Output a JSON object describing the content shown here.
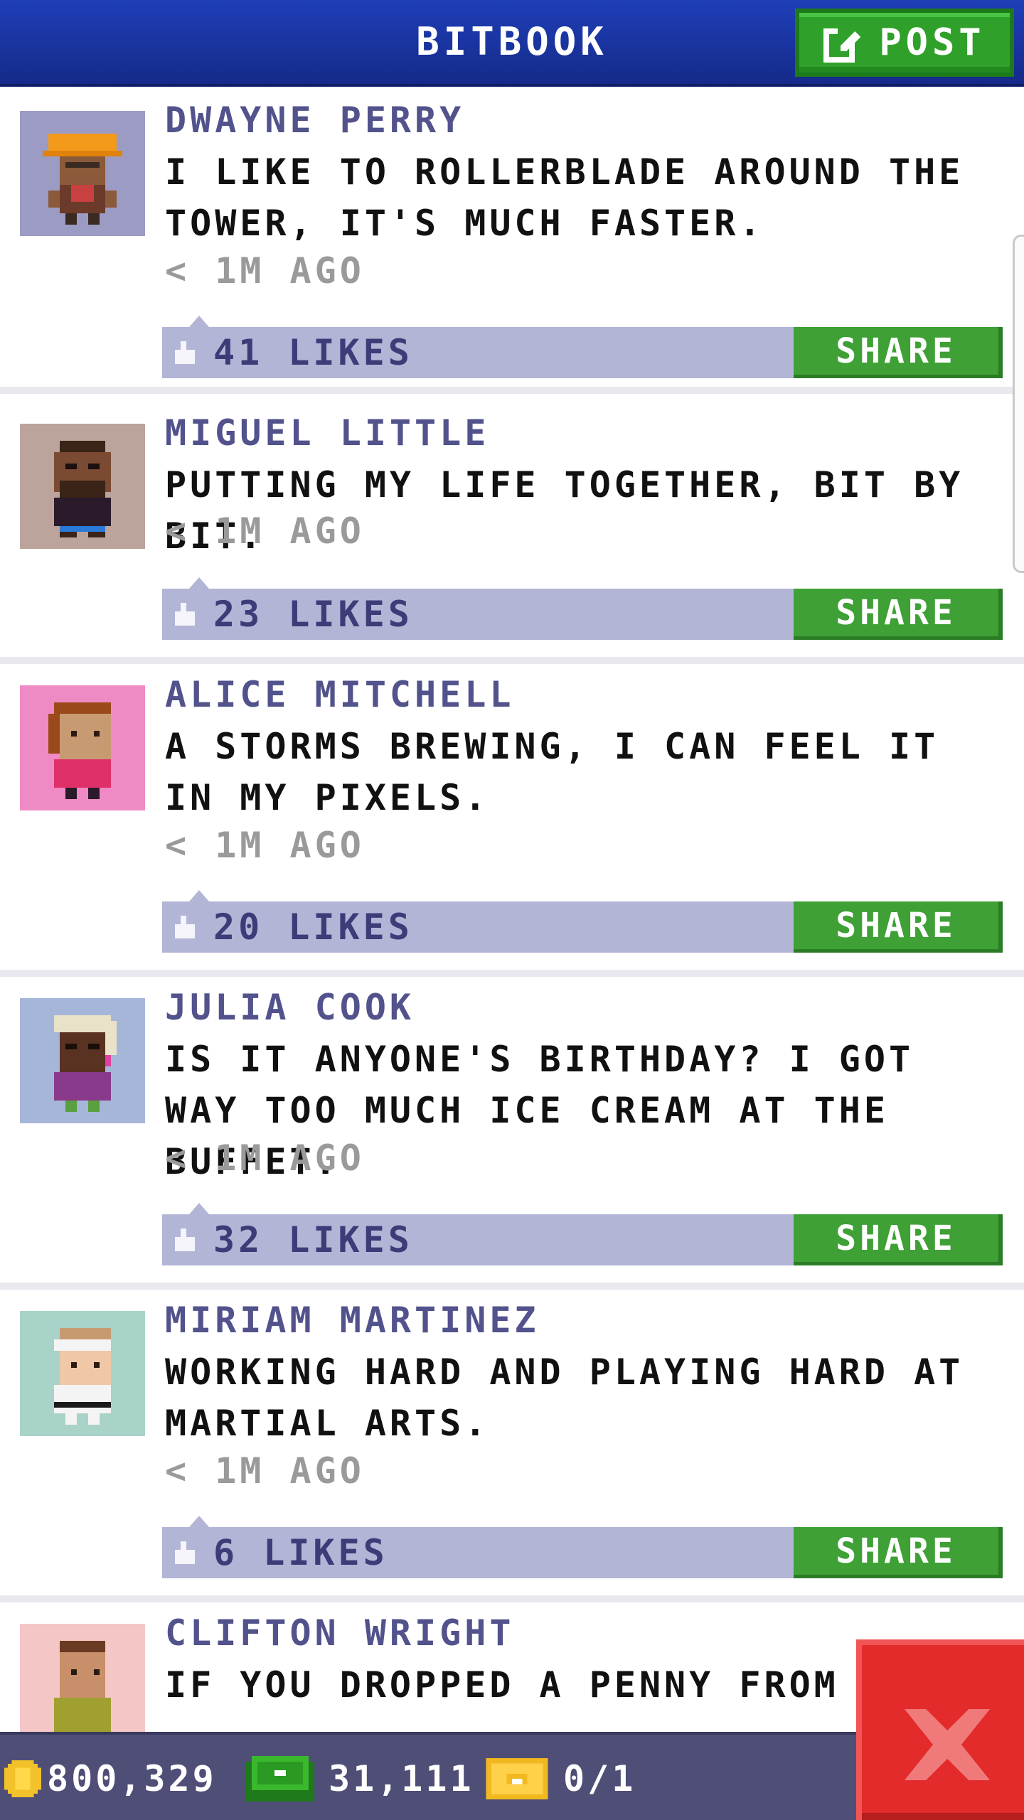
{
  "header": {
    "title": "BITBOOK",
    "post_label": "POST"
  },
  "posts": [
    {
      "name": "DWAYNE PERRY",
      "text": "I LIKE TO ROLLERBLADE AROUND THE TOWER, IT'S MUCH FASTER.",
      "time": "< 1M AGO",
      "likes": "41 LIKES",
      "share_label": "SHARE",
      "avatar_bg": "#9b9bc4"
    },
    {
      "name": "MIGUEL LITTLE",
      "text": "PUTTING MY LIFE TOGETHER, BIT BY BIT.",
      "time": "< 1M AGO",
      "likes": "23 LIKES",
      "share_label": "SHARE",
      "avatar_bg": "#bca49c"
    },
    {
      "name": "ALICE MITCHELL",
      "text": "A STORMS BREWING, I CAN FEEL IT IN MY PIXELS.",
      "time": "< 1M AGO",
      "likes": "20 LIKES",
      "share_label": "SHARE",
      "avatar_bg": "#f08ac4"
    },
    {
      "name": "JULIA COOK",
      "text": "IS IT ANYONE'S BIRTHDAY? I GOT WAY TOO MUCH ICE CREAM AT THE BUFFET.",
      "time": "< 1M AGO",
      "likes": "32 LIKES",
      "share_label": "SHARE",
      "avatar_bg": "#a6b6d8"
    },
    {
      "name": "MIRIAM MARTINEZ",
      "text": "WORKING HARD AND PLAYING HARD AT MARTIAL ARTS.",
      "time": "< 1M AGO",
      "likes": "6 LIKES",
      "share_label": "SHARE",
      "avatar_bg": "#a9d2c8"
    },
    {
      "name": "CLIFTON WRIGHT",
      "text": "IF YOU DROPPED A PENNY FROM",
      "avatar_bg": "#f4c6c6"
    }
  ],
  "status_bar": {
    "coins": "800,329",
    "bux": "31,111",
    "tickets": "0/1"
  },
  "colors": {
    "header": "#1f3fb8",
    "accent_green": "#3ea035",
    "like_bar": "#b3b5d6",
    "close_red": "#e32b2b"
  }
}
